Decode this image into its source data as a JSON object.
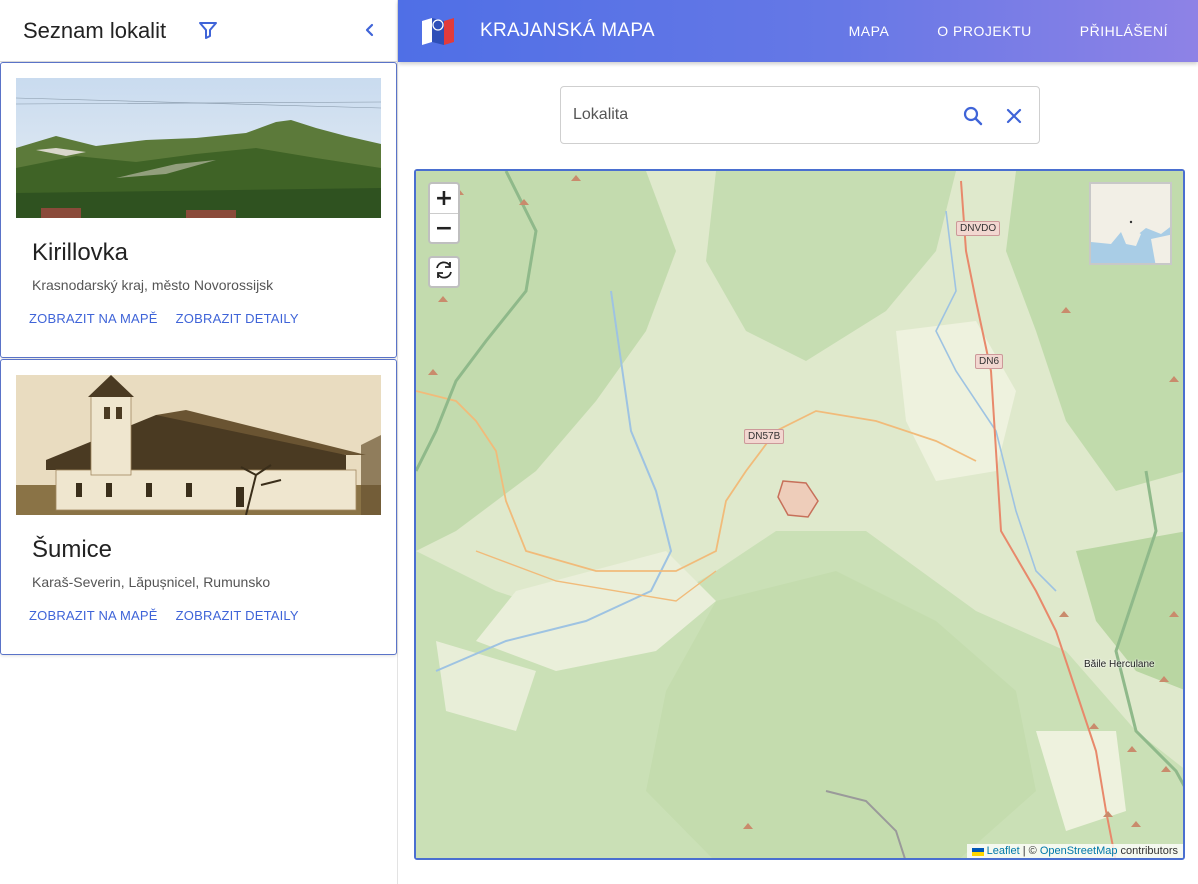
{
  "sidebar": {
    "title": "Seznam lokalit",
    "cards": [
      {
        "name": "Kirillovka",
        "subtitle": "Krasnodarský kraj, město Novorossijsk",
        "show_on_map": "ZOBRAZIT NA MAPĚ",
        "show_details": "ZOBRAZIT DETAILY"
      },
      {
        "name": "Šumice",
        "subtitle": "Karaš-Severin, Lăpușnicel, Rumunsko",
        "show_on_map": "ZOBRAZIT NA MAPĚ",
        "show_details": "ZOBRAZIT DETAILY"
      }
    ]
  },
  "header": {
    "title": "KRAJANSKÁ MAPA",
    "nav": [
      "MAPA",
      "O PROJEKTU",
      "PŘIHLÁŠENÍ"
    ]
  },
  "search": {
    "placeholder": "Lokalita"
  },
  "map": {
    "zoom_in": "+",
    "zoom_out": "−",
    "road_labels": [
      "DNVDO",
      "DN6",
      "DN57B"
    ],
    "place_labels": [
      "Băile Herculane"
    ],
    "attribution": {
      "leaflet": "Leaflet",
      "separator": " | © ",
      "osm": "OpenStreetMap",
      "suffix": " contributors"
    }
  },
  "colors": {
    "accent": "#3f64d8",
    "header_start": "#4f6fe6",
    "header_end": "#8e82e6",
    "map_border": "#4a6fd0"
  }
}
